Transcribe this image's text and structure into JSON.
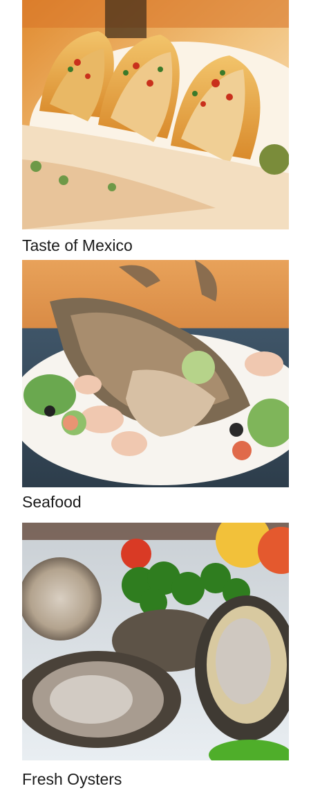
{
  "items": [
    {
      "caption": "Taste of Mexico",
      "image": "tacos-photo"
    },
    {
      "caption": "Seafood",
      "image": "seafood-platter-photo"
    },
    {
      "caption": "Fresh Oysters",
      "image": "oysters-on-ice-photo"
    }
  ]
}
